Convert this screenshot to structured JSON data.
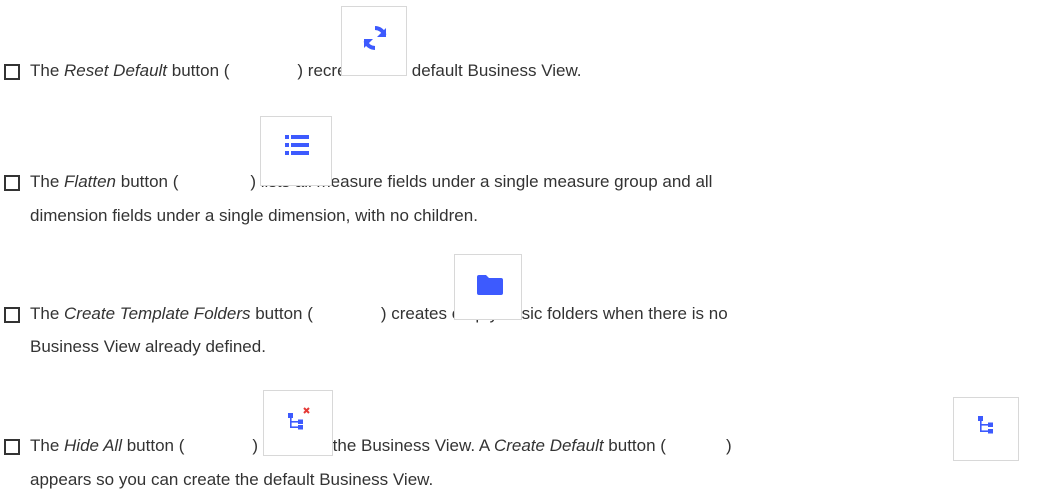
{
  "items": [
    {
      "pre": "The ",
      "name": "Reset Default",
      "mid": " button (",
      "post": ") recreates the default Business View.",
      "icon": "refresh-icon"
    },
    {
      "pre": "The ",
      "name": "Flatten",
      "mid": " button (",
      "post": ") lists all measure fields under a single measure group and all",
      "line2": "dimension fields under a single dimension, with no children.",
      "icon": "list-icon"
    },
    {
      "pre": "The ",
      "name": "Create Template Folders",
      "mid": " button (",
      "post": ") creates empty basic folders when there is no",
      "line2": "Business View already defined.",
      "icon": "folder-icon"
    },
    {
      "pre": "The ",
      "name": "Hide All",
      "mid": " button (",
      "post": ") removes the Business View. A ",
      "name2": "Create Default",
      "mid2": " button (",
      "post2": ")",
      "line2": "appears so you can create the default Business View.",
      "icon": "hierarchy-remove-icon",
      "icon2": "hierarchy-icon"
    }
  ],
  "colors": {
    "icon_blue": "#3d5afe",
    "remove_red": "#e53935",
    "text": "#333333"
  }
}
